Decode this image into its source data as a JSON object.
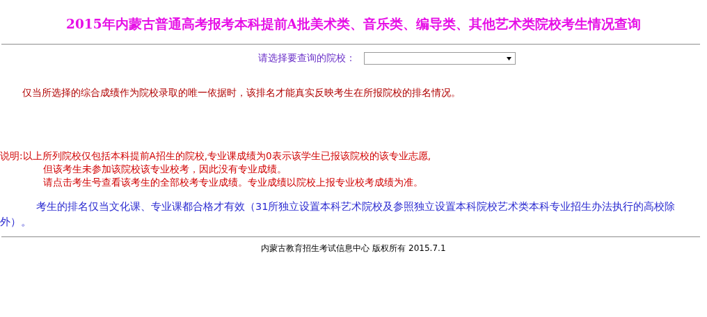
{
  "title": "2015年内蒙古普通高考报考本科提前A批美术类、音乐类、编导类、其他艺术类院校考生情况查询",
  "school_select": {
    "label": "请选择要查询的院校："
  },
  "ranking_note": "仅当所选择的综合成绩作为院校录取的唯一依据时，该排名才能真实反映考生在所报院校的排名情况。",
  "explanation": {
    "label": "说明:",
    "lines": [
      "以上所列院校仅包括本科提前A招生的院校,专业课成绩为0表示该学生已报该院校的该专业志愿,",
      "但该考生未参加该院校该专业校考，因此没有专业成绩。",
      "请点击考生号查看该考生的全部校考专业成绩。专业成绩以院校上报专业校考成绩为准。"
    ]
  },
  "validity_note": "考生的排名仅当文化课、专业课都合格才有效（31所独立设置本科艺术院校及参照独立设置本科院校艺术类本科专业招生办法执行的高校除外）。",
  "footer": "内蒙古教育招生考试信息中心 版权所有 2015.7.1"
}
